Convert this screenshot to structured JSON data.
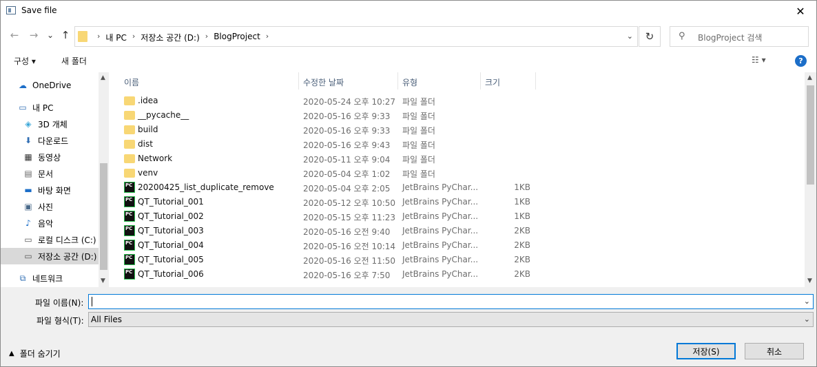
{
  "window": {
    "title": "Save file",
    "close": "✕"
  },
  "address": {
    "crumbs": [
      "내 PC",
      "저장소 공간 (D:)",
      "BlogProject"
    ],
    "search_placeholder": "BlogProject 검색"
  },
  "toolbar": {
    "organize": "구성 ▾",
    "new_folder": "새 폴더",
    "help": "?"
  },
  "nav": {
    "items": [
      {
        "label": "OneDrive",
        "icon": "onedrive-icon"
      },
      {
        "label": "내 PC",
        "icon": "pc-icon"
      },
      {
        "label": "3D 개체",
        "icon": "3d-objects-icon"
      },
      {
        "label": "다운로드",
        "icon": "download-icon"
      },
      {
        "label": "동영상",
        "icon": "video-icon"
      },
      {
        "label": "문서",
        "icon": "document-icon"
      },
      {
        "label": "바탕 화면",
        "icon": "desktop-icon"
      },
      {
        "label": "사진",
        "icon": "picture-icon"
      },
      {
        "label": "음악",
        "icon": "music-icon"
      },
      {
        "label": "로컬 디스크 (C:)",
        "icon": "drive-icon"
      },
      {
        "label": "저장소 공간 (D:)",
        "icon": "drive-icon"
      },
      {
        "label": "네트워크",
        "icon": "network-icon"
      }
    ]
  },
  "columns": {
    "name": "이름",
    "date": "수정한 날짜",
    "type": "유형",
    "size": "크기"
  },
  "files": [
    {
      "name": ".idea",
      "date": "2020-05-24 오후 10:27",
      "type": "파일 폴더",
      "size": "",
      "kind": "folder"
    },
    {
      "name": "__pycache__",
      "date": "2020-05-16 오후 9:33",
      "type": "파일 폴더",
      "size": "",
      "kind": "folder"
    },
    {
      "name": "build",
      "date": "2020-05-16 오후 9:33",
      "type": "파일 폴더",
      "size": "",
      "kind": "folder"
    },
    {
      "name": "dist",
      "date": "2020-05-16 오후 9:43",
      "type": "파일 폴더",
      "size": "",
      "kind": "folder"
    },
    {
      "name": "Network",
      "date": "2020-05-11 오후 9:04",
      "type": "파일 폴더",
      "size": "",
      "kind": "folder"
    },
    {
      "name": "venv",
      "date": "2020-05-04 오후 1:02",
      "type": "파일 폴더",
      "size": "",
      "kind": "folder"
    },
    {
      "name": "20200425_list_duplicate_remove",
      "date": "2020-05-04 오후 2:05",
      "type": "JetBrains PyChar...",
      "size": "1KB",
      "kind": "py"
    },
    {
      "name": "QT_Tutorial_001",
      "date": "2020-05-12 오후 10:50",
      "type": "JetBrains PyChar...",
      "size": "1KB",
      "kind": "py"
    },
    {
      "name": "QT_Tutorial_002",
      "date": "2020-05-15 오후 11:23",
      "type": "JetBrains PyChar...",
      "size": "1KB",
      "kind": "py"
    },
    {
      "name": "QT_Tutorial_003",
      "date": "2020-05-16 오전 9:40",
      "type": "JetBrains PyChar...",
      "size": "2KB",
      "kind": "py"
    },
    {
      "name": "QT_Tutorial_004",
      "date": "2020-05-16 오전 10:14",
      "type": "JetBrains PyChar...",
      "size": "2KB",
      "kind": "py"
    },
    {
      "name": "QT_Tutorial_005",
      "date": "2020-05-16 오전 11:50",
      "type": "JetBrains PyChar...",
      "size": "2KB",
      "kind": "py"
    },
    {
      "name": "QT_Tutorial_006",
      "date": "2020-05-16 오후 7:50",
      "type": "JetBrains PyChar...",
      "size": "2KB",
      "kind": "py"
    }
  ],
  "form": {
    "filename_label": "파일 이름(N):",
    "filename_value": "",
    "filetype_label": "파일 형식(T):",
    "filetype_value": "All Files",
    "hide_folders": "폴더 숨기기",
    "save": "저장(S)",
    "cancel": "취소"
  }
}
